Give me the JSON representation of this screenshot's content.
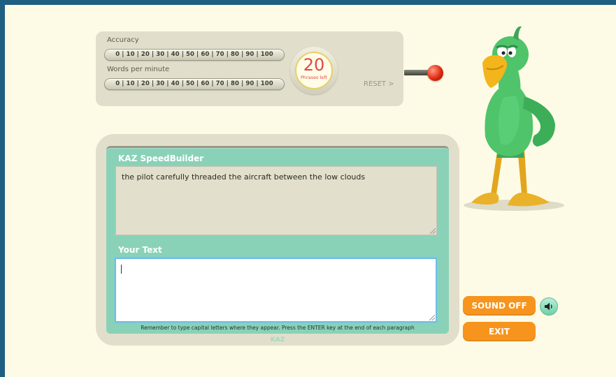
{
  "stats": {
    "accuracy_label": "Accuracy",
    "accuracy_scale": "0 | 10 | 20 | 30 | 40 | 50 | 60 | 70 | 80 | 90 | 100",
    "wpm_label": "Words per minute",
    "wpm_scale": "0 | 10 | 20 | 30 | 40 | 50 | 60 | 70 | 80 | 90 | 100",
    "phrases_left": "20",
    "phrases_left_label": "Phrases left",
    "reset_label": "RESET >"
  },
  "main": {
    "title": "KAZ SpeedBuilder",
    "phrase": "the pilot carefully threaded the aircraft between the low clouds",
    "your_text_label": "Your Text",
    "your_text_value": "",
    "hint": "Remember to type capital letters where they appear. Press the ENTER key at the end of each paragraph",
    "footer": "KAZ"
  },
  "controls": {
    "sound_label": "SOUND OFF",
    "exit_label": "EXIT"
  },
  "icons": {
    "speaker": "speaker-icon",
    "lever": "lever-icon",
    "mascot": "parrot-mascot"
  },
  "colors": {
    "frame": "#1e5f82",
    "background": "#fdfbe6",
    "panel": "#e1dfcb",
    "teal": "#89d2b8",
    "orange": "#f7941d",
    "gauge_red": "#e24848"
  }
}
